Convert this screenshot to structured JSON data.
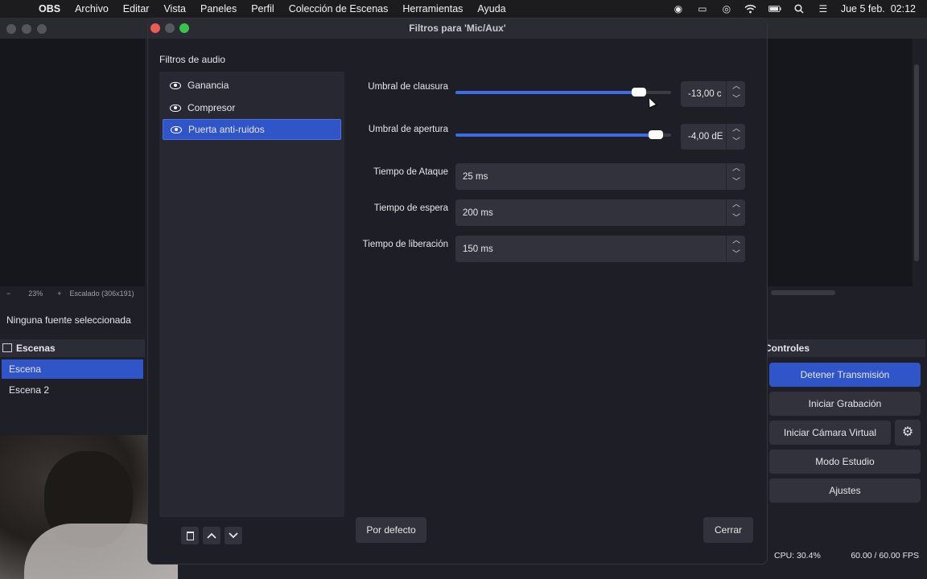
{
  "menubar": {
    "app": "OBS",
    "items": [
      "Archivo",
      "Editar",
      "Vista",
      "Paneles",
      "Perfil",
      "Colección de Escenas",
      "Herramientas",
      "Ayuda"
    ],
    "clock": "Jue 5 feb.  02:12"
  },
  "main": {
    "zoom_minus": "−",
    "zoom_pct": "23%",
    "zoom_plus": "+",
    "scale_text": "Escalado (306x191)",
    "no_source": "Ninguna fuente seleccionada",
    "scenes_title": "Escenas",
    "scenes": [
      "Escena",
      "Escena 2"
    ],
    "controls_title": "Controles",
    "controls": [
      "Detener Transmisión",
      "Iniciar Grabación",
      "Iniciar Cámara Virtual",
      "Modo Estudio",
      "Ajustes"
    ],
    "cpu": "CPU: 30.4%",
    "fps": "60.00 / 60.00 FPS"
  },
  "dialog": {
    "title": "Filtros para 'Mic/Aux'",
    "section_label": "Filtros de audio",
    "filters": [
      "Ganancia",
      "Compresor",
      "Puerta anti-ruidos"
    ],
    "selected_filter_index": 2,
    "close_threshold": {
      "label": "Umbral de clausura",
      "value": "-13,00 c",
      "level": 0.85
    },
    "open_threshold": {
      "label": "Umbral de apertura",
      "value": "-4,00 dE",
      "level": 0.93
    },
    "attack": {
      "label": "Tiempo de Ataque",
      "value": "25 ms"
    },
    "hold": {
      "label": "Tiempo de espera",
      "value": "200 ms"
    },
    "release": {
      "label": "Tiempo de liberación",
      "value": "150 ms"
    },
    "defaults_button": "Por defecto",
    "close_button": "Cerrar"
  }
}
